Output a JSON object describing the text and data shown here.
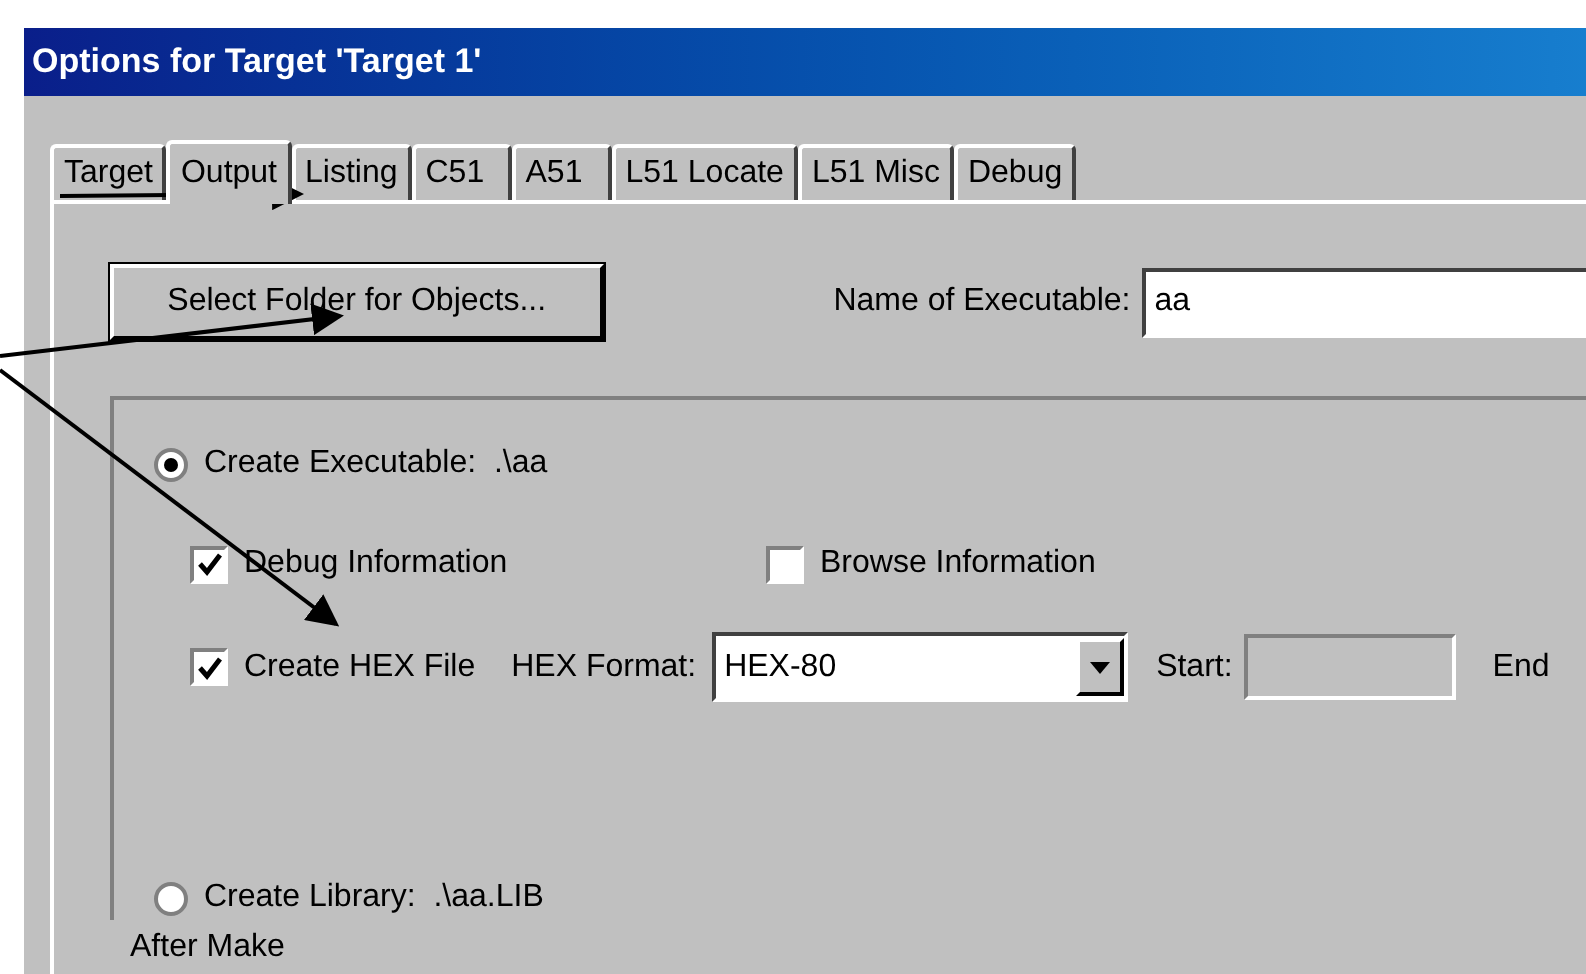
{
  "window": {
    "title": "Options for Target 'Target 1'"
  },
  "tabs": [
    {
      "label": "Target",
      "selected": false
    },
    {
      "label": "Output",
      "selected": true
    },
    {
      "label": "Listing",
      "selected": false
    },
    {
      "label": "C51",
      "selected": false
    },
    {
      "label": "A51",
      "selected": false
    },
    {
      "label": "L51 Locate",
      "selected": false
    },
    {
      "label": "L51 Misc",
      "selected": false
    },
    {
      "label": "Debug",
      "selected": false
    }
  ],
  "select_folder_button": "Select Folder for Objects...",
  "name_of_executable": {
    "label": "Name of Executable:",
    "value": "aa"
  },
  "create_executable": {
    "label": "Create Executable:  .\\aa",
    "selected": true
  },
  "debug_information": {
    "label": "Debug Information",
    "checked": true
  },
  "browse_information": {
    "label": "Browse Information",
    "checked": false
  },
  "create_hex_file": {
    "label": "Create HEX File",
    "checked": true
  },
  "hex_format": {
    "label": "HEX Format:",
    "value": "HEX-80"
  },
  "start": {
    "label": "Start:"
  },
  "end": {
    "label": "End"
  },
  "create_library": {
    "label": "Create Library:  .\\aa.LIB",
    "selected": false
  },
  "after_make": {
    "label": "After Make"
  }
}
